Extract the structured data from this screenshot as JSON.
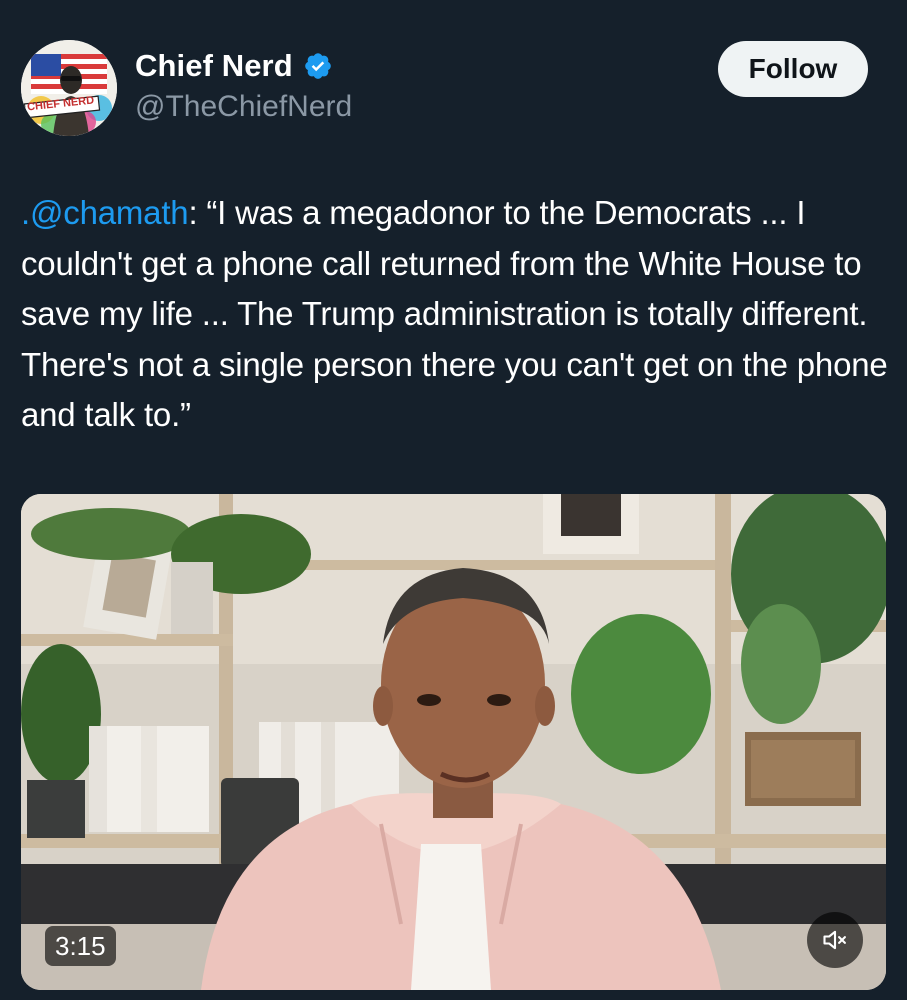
{
  "author": {
    "display_name": "Chief Nerd",
    "handle": "@TheChiefNerd",
    "avatar_text": "CHIEF NERD",
    "verified_icon": "verified-badge-icon"
  },
  "header": {
    "follow_label": "Follow"
  },
  "tweet": {
    "mention": ".@chamath",
    "body": ": “I was a megadonor to the Democrats ... I couldn't get a phone call returned from the White House to save my life ... The Trump administration is totally different. There's not a single person there you can't get on the phone and talk to.”"
  },
  "video": {
    "duration": "3:15",
    "mute_icon": "speaker-muted-icon"
  },
  "colors": {
    "background": "#15202b",
    "accent": "#1d9bf0",
    "secondary_text": "#8b98a5",
    "button_bg": "#eff3f4"
  }
}
